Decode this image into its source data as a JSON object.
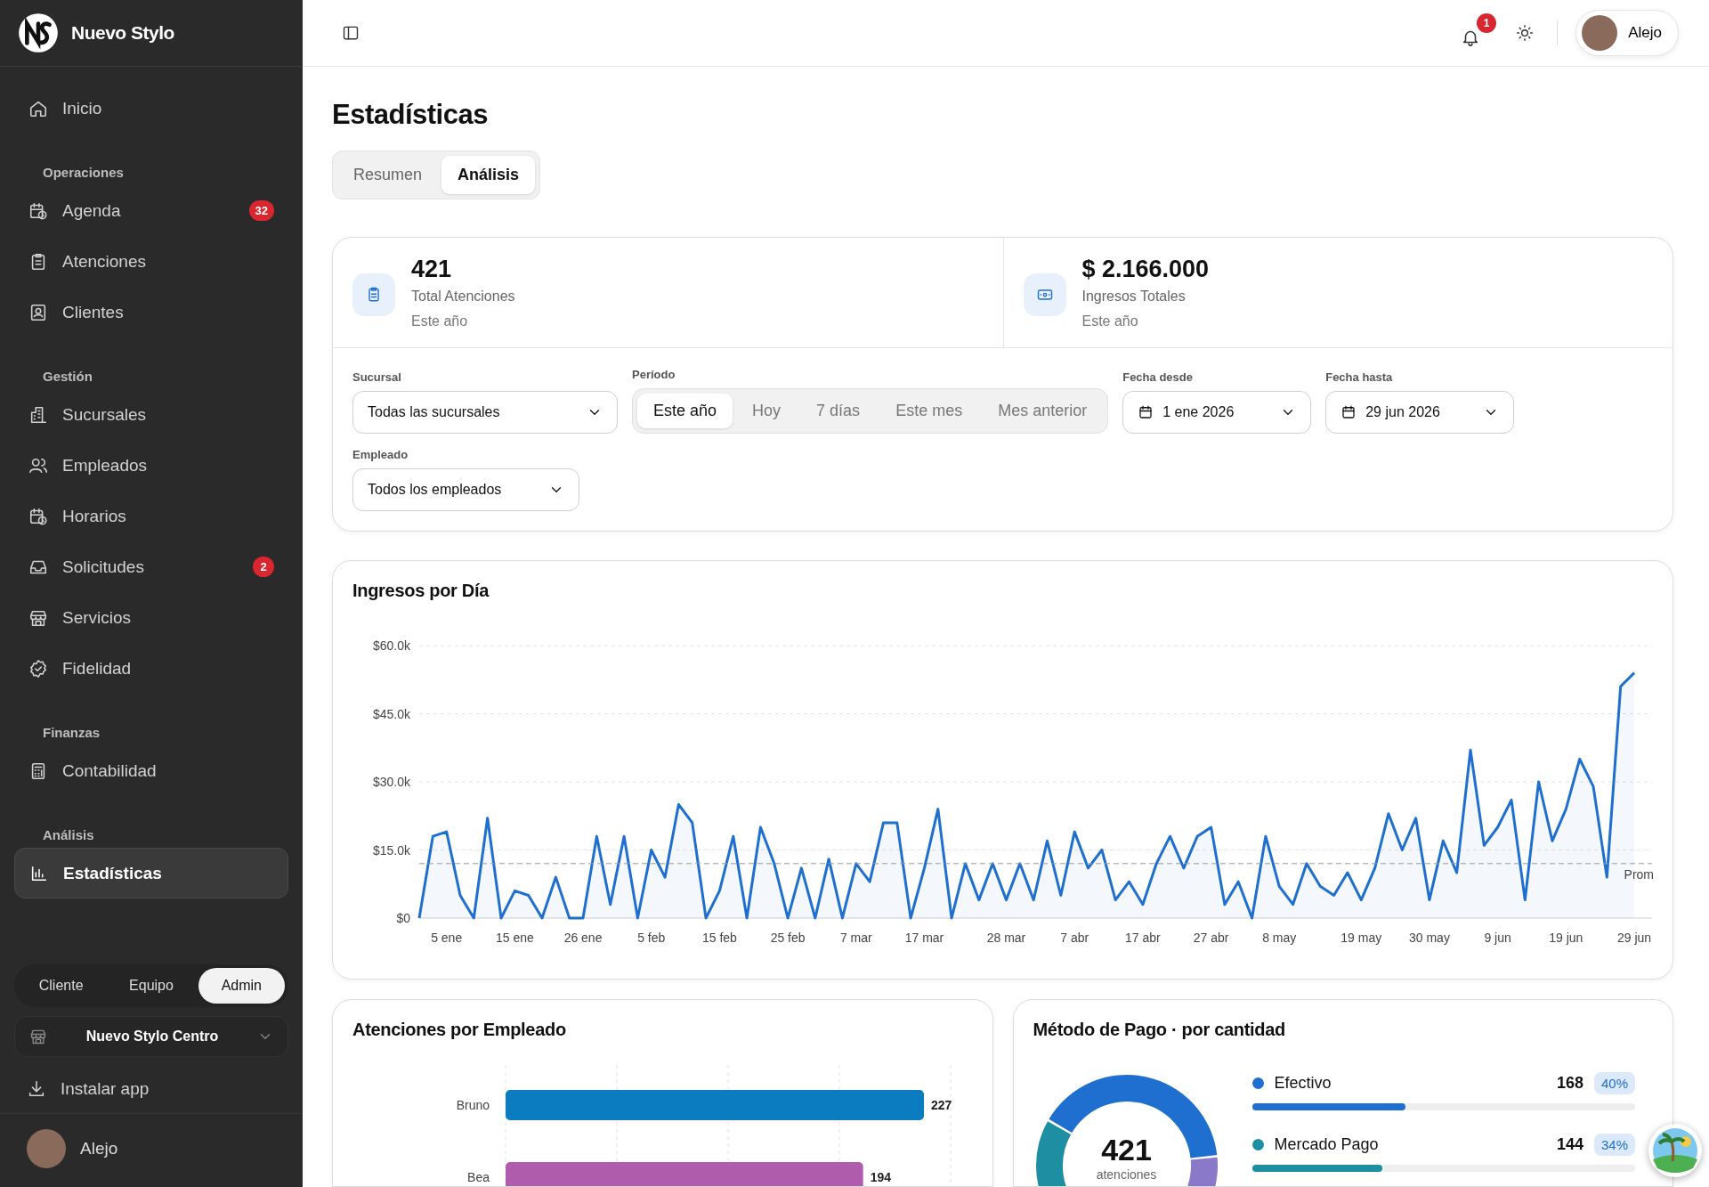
{
  "sidebar": {
    "brand": "Nuevo Stylo",
    "nav": [
      {
        "kind": "item",
        "label": "Inicio",
        "selected": false
      },
      {
        "kind": "heading",
        "label": "Operaciones"
      },
      {
        "kind": "item",
        "label": "Agenda",
        "selected": false,
        "badge": "32"
      },
      {
        "kind": "item",
        "label": "Atenciones",
        "selected": false
      },
      {
        "kind": "item",
        "label": "Clientes",
        "selected": false
      },
      {
        "kind": "heading",
        "label": "Gestión"
      },
      {
        "kind": "item",
        "label": "Sucursales",
        "selected": false
      },
      {
        "kind": "item",
        "label": "Empleados",
        "selected": false
      },
      {
        "kind": "item",
        "label": "Horarios",
        "selected": false
      },
      {
        "kind": "item",
        "label": "Solicitudes",
        "selected": false,
        "badge": "2"
      },
      {
        "kind": "item",
        "label": "Servicios",
        "selected": false
      },
      {
        "kind": "item",
        "label": "Fidelidad",
        "selected": false
      },
      {
        "kind": "heading",
        "label": "Finanzas"
      },
      {
        "kind": "item",
        "label": "Contabilidad",
        "selected": false
      },
      {
        "kind": "heading",
        "label": "Análisis"
      },
      {
        "kind": "item",
        "label": "Estadísticas",
        "selected": true
      }
    ],
    "roles": [
      {
        "label": "Cliente",
        "selected": false
      },
      {
        "label": "Equipo",
        "selected": false
      },
      {
        "label": "Admin",
        "selected": true
      }
    ],
    "branch": "Nuevo Stylo Centro",
    "install": "Instalar app",
    "user": "Alejo"
  },
  "header": {
    "notifications": "1",
    "user": "Alejo"
  },
  "page": {
    "title": "Estadísticas",
    "tabs": [
      {
        "label": "Resumen",
        "selected": false
      },
      {
        "label": "Análisis",
        "selected": true
      }
    ],
    "stats": [
      {
        "value": "421",
        "label": "Total Atenciones",
        "sub": "Este año"
      },
      {
        "value": "$ 2.166.000",
        "label": "Ingresos Totales",
        "sub": "Este año"
      }
    ],
    "filters": {
      "branch": {
        "label": "Sucursal",
        "value": "Todas las sucursales"
      },
      "period": {
        "label": "Período",
        "options": [
          {
            "label": "Este año",
            "selected": true
          },
          {
            "label": "Hoy",
            "selected": false
          },
          {
            "label": "7 días",
            "selected": false
          },
          {
            "label": "Este mes",
            "selected": false
          },
          {
            "label": "Mes anterior",
            "selected": false
          }
        ]
      },
      "from": {
        "label": "Fecha desde",
        "value": "1 ene 2026"
      },
      "to": {
        "label": "Fecha hasta",
        "value": "29 jun 2026"
      },
      "employee": {
        "label": "Empleado",
        "value": "Todos los empleados"
      }
    },
    "revenue": {
      "title": "Ingresos por Día",
      "chart_data": {
        "type": "line",
        "categories": [
          null,
          null,
          "5 ene",
          null,
          null,
          null,
          null,
          "15 ene",
          null,
          null,
          null,
          null,
          "26 ene",
          null,
          null,
          null,
          null,
          "5 feb",
          null,
          null,
          null,
          null,
          "15 feb",
          null,
          null,
          null,
          null,
          "25 feb",
          null,
          null,
          null,
          null,
          "7 mar",
          null,
          null,
          null,
          null,
          "17 mar",
          null,
          null,
          null,
          null,
          null,
          "28 mar",
          null,
          null,
          null,
          null,
          "7 abr",
          null,
          null,
          null,
          null,
          "17 abr",
          null,
          null,
          null,
          null,
          "27 abr",
          null,
          null,
          null,
          null,
          "8 may",
          null,
          null,
          null,
          null,
          null,
          "19 may",
          null,
          null,
          null,
          null,
          "30 may",
          null,
          null,
          null,
          null,
          "9 jun",
          null,
          null,
          null,
          null,
          "19 jun",
          null,
          null,
          null,
          null,
          "29 jun"
        ],
        "series": [
          {
            "color": "#1f6fd1",
            "values": [
              0,
              18,
              19,
              5,
              0,
              22,
              0,
              6,
              5,
              0,
              9,
              0,
              0,
              18,
              3,
              18,
              0,
              15,
              9,
              25,
              21,
              0,
              6,
              18,
              0,
              20,
              12,
              0,
              11,
              0,
              13,
              0,
              12,
              8,
              21,
              21,
              0,
              11,
              24,
              0,
              12,
              4,
              12,
              4,
              12,
              4,
              17,
              5,
              19,
              11,
              15,
              4,
              8,
              3,
              12,
              18,
              11,
              18,
              20,
              3,
              8,
              0,
              18,
              7,
              3,
              12,
              7,
              5,
              10,
              4,
              11,
              23,
              15,
              22,
              4,
              17,
              10,
              37,
              16,
              20,
              26,
              4,
              30,
              17,
              24,
              35,
              29,
              9,
              51,
              54
            ]
          }
        ],
        "yticks": [
          {
            "value": 0,
            "label": "$0"
          },
          {
            "value": 15,
            "label": "$15.0k"
          },
          {
            "value": 30,
            "label": "$30.0k"
          },
          {
            "value": 45,
            "label": "$45.0k"
          },
          {
            "value": 60,
            "label": "$60.0k"
          }
        ],
        "ylim": [
          0,
          60
        ],
        "grid": true,
        "ref_lines": [
          {
            "axis": "y",
            "value": 12,
            "label": "Prom"
          }
        ]
      }
    },
    "employees": {
      "title": "Atenciones por Empleado",
      "chart_data": {
        "type": "bar",
        "orientation": "horizontal",
        "categories": [
          "Bruno",
          "Bea"
        ],
        "values": [
          227,
          194
        ],
        "colors": [
          "#0a7cbf",
          "#b05cad"
        ],
        "data_labels": true
      }
    },
    "payments": {
      "title": "Método de Pago · por cantidad",
      "total": "421",
      "total_label": "atenciones",
      "chart_data": {
        "type": "donut",
        "categories": [
          "Efectivo",
          "Mercado Pago",
          null
        ],
        "values": [
          40,
          34,
          26
        ]
      },
      "items": [
        {
          "count": "168",
          "percent": "40%",
          "color": "#1f6fd1",
          "level": 0.4
        },
        {
          "count": "144",
          "percent": "34%",
          "color": "#1e8fa3",
          "level": 0.34
        }
      ]
    }
  }
}
